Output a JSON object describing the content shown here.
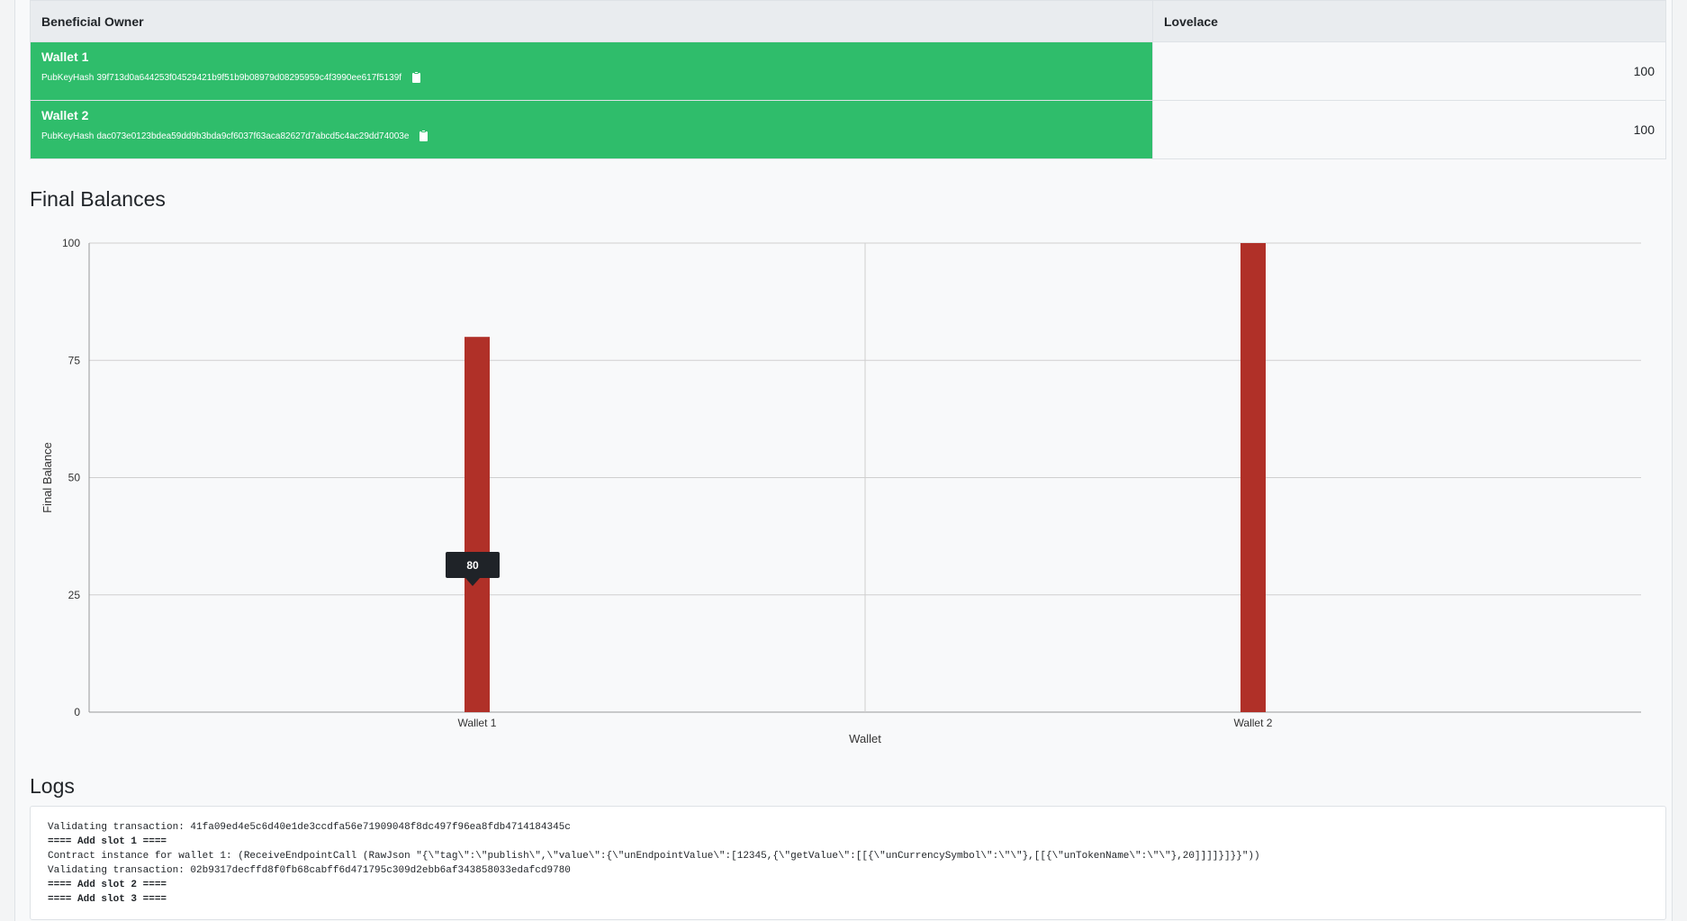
{
  "table": {
    "headers": {
      "owner": "Beneficial Owner",
      "lovelace": "Lovelace"
    },
    "rows": [
      {
        "wallet": "Wallet 1",
        "pkh_prefix": "PubKeyHash",
        "pkh": "39f713d0a644253f04529421b9f51b9b08979d08295959c4f3990ee617f5139f",
        "lovelace": "100"
      },
      {
        "wallet": "Wallet 2",
        "pkh_prefix": "PubKeyHash",
        "pkh": "dac073e0123bdea59dd9b3bda9cf6037f63aca82627d7abcd5c4ac29dd74003e",
        "lovelace": "100"
      }
    ],
    "colors": {
      "owner_bg": "#2fbd6b"
    }
  },
  "final_balances": {
    "heading": "Final Balances"
  },
  "chart_data": {
    "type": "bar",
    "categories": [
      "Wallet 1",
      "Wallet 2"
    ],
    "values": [
      80,
      100
    ],
    "xlabel": "Wallet",
    "ylabel": "Final Balance",
    "ylim": [
      0,
      100
    ],
    "yticks": [
      0,
      25,
      50,
      75,
      100
    ],
    "grid": true,
    "bar_color": "#b03028",
    "tooltip": {
      "category": "Wallet 1",
      "value": "80"
    }
  },
  "logs": {
    "heading": "Logs",
    "lines": [
      {
        "text": "Validating transaction: 41fa09ed4e5c6d40e1de3ccdfa56e71909048f8dc497f96ea8fdb4714184345c",
        "bold": false
      },
      {
        "text": "==== Add slot 1 ====",
        "bold": true
      },
      {
        "text": "Contract instance for wallet 1: (ReceiveEndpointCall (RawJson \"{\\\"tag\\\":\\\"publish\\\",\\\"value\\\":{\\\"unEndpointValue\\\":[12345,{\\\"getValue\\\":[[{\\\"unCurrencySymbol\\\":\\\"\\\"},[[{\\\"unTokenName\\\":\\\"\\\"},20]]]]}]}}\"))",
        "bold": false
      },
      {
        "text": "Validating transaction: 02b9317decffd8f0fb68cabff6d471795c309d2ebb6af343858033edafcd9780",
        "bold": false
      },
      {
        "text": "==== Add slot 2 ====",
        "bold": true
      },
      {
        "text": "==== Add slot 3 ====",
        "bold": true
      }
    ]
  }
}
